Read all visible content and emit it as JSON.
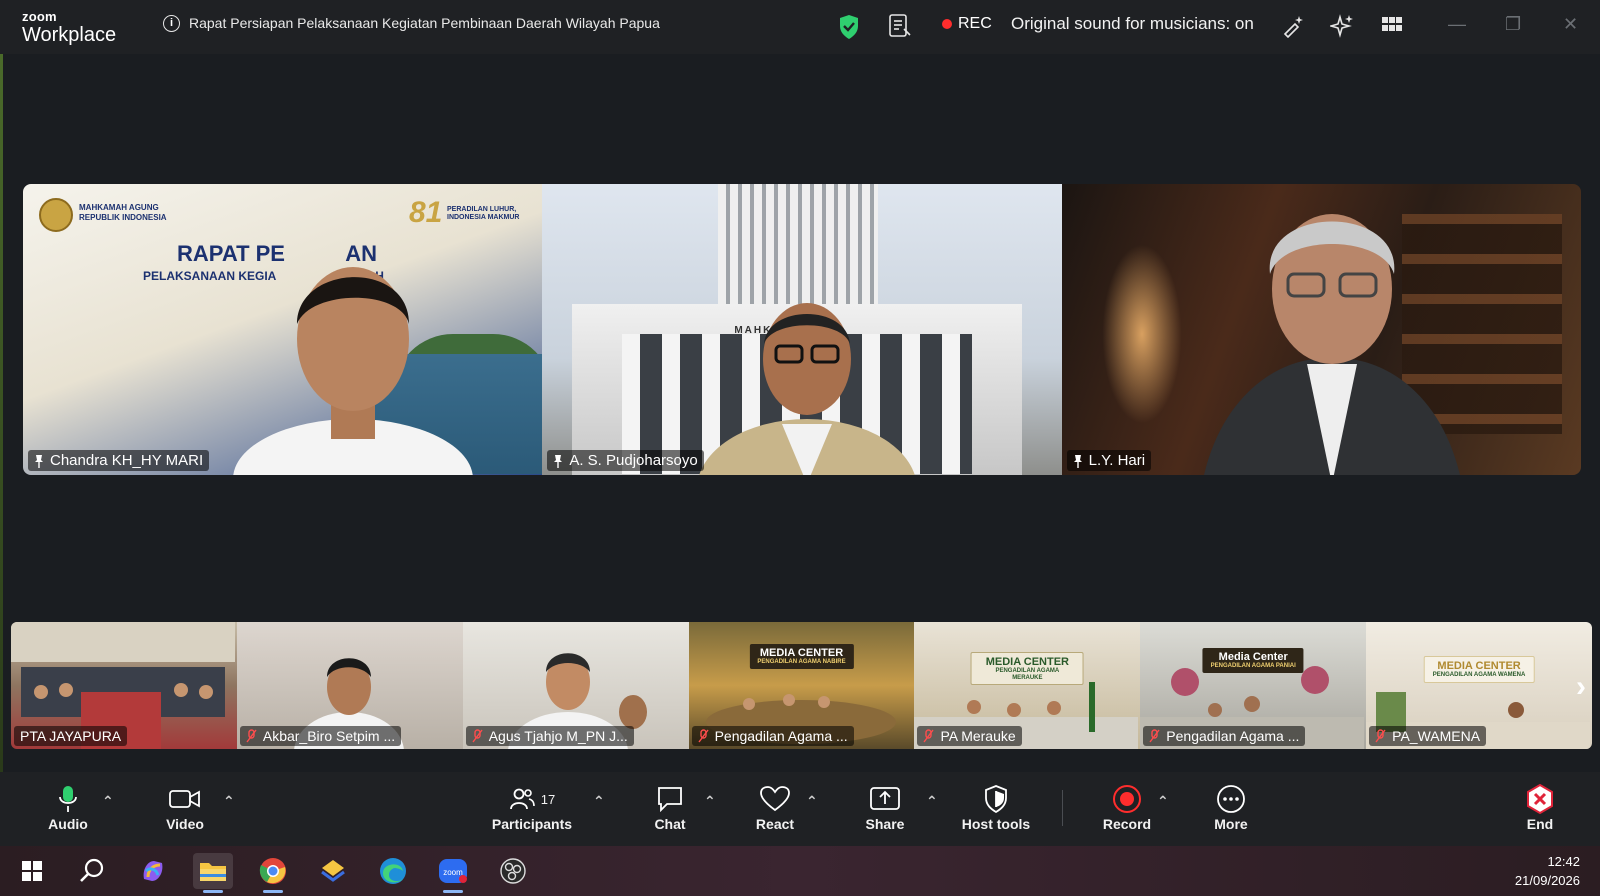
{
  "titlebar": {
    "logo_line1": "zoom",
    "logo_line2": "Workplace",
    "meeting_title": "Rapat Persiapan Pelaksanaan Kegiatan Pembinaan Daerah Wilayah Papua",
    "rec_label": "REC",
    "sound_status": "Original sound for musicians: on"
  },
  "main_tiles": [
    {
      "name": "Chandra KH_HY MARI"
    },
    {
      "name": "A. S. Pudjoharsoyo"
    },
    {
      "name": "L.Y. Hari"
    }
  ],
  "tile1_banner": {
    "org": "MAHKAMAH AGUNG",
    "org_sub": "REPUBLIK INDONESIA",
    "title": "RAPAT PE          AN",
    "subtitle": "PELAKSANAAN KEGIA                 DAERAH",
    "anniv": "81",
    "anniv_sub1": "PERADILAN LUHUR,",
    "anniv_sub2": "INDONESIA MAKMUR"
  },
  "tile2_building_text": "MAHKA",
  "thumbnails": [
    {
      "name": "PTA JAYAPURA",
      "muted": false
    },
    {
      "name": "Akbar_Biro Setpim ...",
      "muted": true
    },
    {
      "name": "Agus Tjahjo M_PN J...",
      "muted": true
    },
    {
      "name": "Pengadilan Agama ...",
      "muted": true,
      "sign": "MEDIA CENTER",
      "sign_sub": "PENGADILAN AGAMA NABIRE"
    },
    {
      "name": "PA Merauke",
      "muted": true,
      "sign": "MEDIA CENTER",
      "sign_sub": "PENGADILAN AGAMA MERAUKE"
    },
    {
      "name": "Pengadilan Agama ...",
      "muted": true,
      "sign": "Media Center",
      "sign_sub": "PENGADILAN AGAMA PANIAI"
    },
    {
      "name": "PA_WAMENA",
      "muted": true,
      "sign": "MEDIA CENTER",
      "sign_sub": "PENGADILAN AGAMA WAMENA"
    }
  ],
  "toolbar": {
    "audio": "Audio",
    "video": "Video",
    "participants": "Participants",
    "participants_count": "17",
    "chat": "Chat",
    "react": "React",
    "share": "Share",
    "host_tools": "Host tools",
    "record": "Record",
    "more": "More",
    "end": "End"
  },
  "taskbar": {
    "time": "12:42",
    "date": "21/09/2026"
  },
  "colors": {
    "rec": "#ff2d2d",
    "shield": "#2fcf6f",
    "end": "#e0243a",
    "bg": "#1a1d21"
  }
}
